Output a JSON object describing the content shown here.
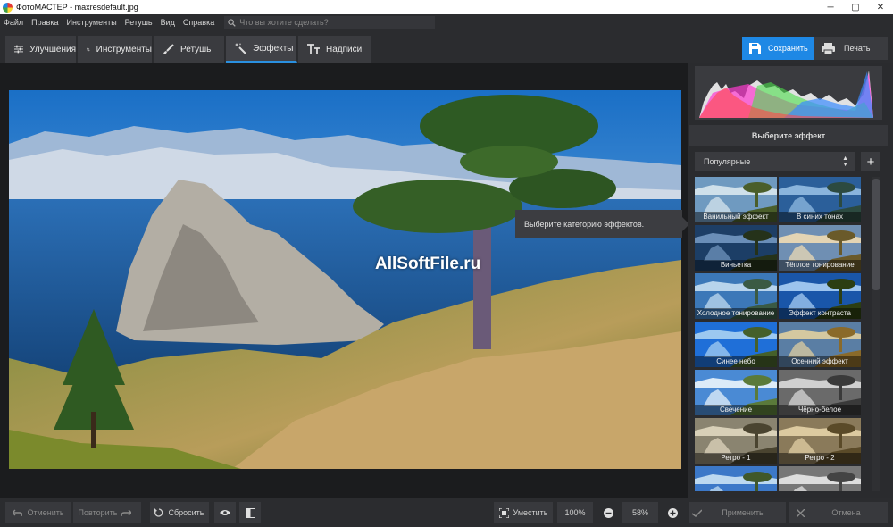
{
  "window": {
    "title": "ФотоМАСТЕР - maxresdefault.jpg",
    "controls": [
      "─",
      "▢",
      "✕"
    ]
  },
  "menu": {
    "items": [
      "Файл",
      "Правка",
      "Инструменты",
      "Ретушь",
      "Вид",
      "Справка"
    ],
    "search_placeholder": "Что вы хотите сделать?"
  },
  "tabs": [
    {
      "label": "Улучшения",
      "icon": "sliders-icon"
    },
    {
      "label": "Инструменты",
      "icon": "crop-icon"
    },
    {
      "label": "Ретушь",
      "icon": "brush-icon"
    },
    {
      "label": "Эффекты",
      "icon": "magic-wand-icon",
      "active": true
    },
    {
      "label": "Надписи",
      "icon": "text-icon"
    }
  ],
  "actions": {
    "save": "Сохранить",
    "print": "Печать"
  },
  "canvas": {
    "watermark": "AllSoftFile.ru",
    "tooltip": "Выберите категорию эффектов."
  },
  "panel": {
    "title": "Выберите эффект",
    "category": "Популярные",
    "add_label": "+",
    "effects": [
      {
        "label": "Ванильный эффект",
        "tone": "vanilla"
      },
      {
        "label": "В синих тонах",
        "tone": "blue"
      },
      {
        "label": "Виньетка",
        "tone": "vignette"
      },
      {
        "label": "Тёплое тонирование",
        "tone": "warm"
      },
      {
        "label": "Холодное тонирование",
        "tone": "cold"
      },
      {
        "label": "Эффект контраста",
        "tone": "contrast"
      },
      {
        "label": "Синее небо",
        "tone": "sky"
      },
      {
        "label": "Осенний эффект",
        "tone": "autumn"
      },
      {
        "label": "Свечение",
        "tone": "glow"
      },
      {
        "label": "Чёрно-белое",
        "tone": "bw"
      },
      {
        "label": "Ретро - 1",
        "tone": "retro1"
      },
      {
        "label": "Ретро - 2",
        "tone": "retro2"
      },
      {
        "label": "",
        "tone": "normal"
      },
      {
        "label": "",
        "tone": "gray"
      }
    ]
  },
  "bottom": {
    "undo": "Отменить",
    "redo": "Повторить",
    "reset": "Сбросить",
    "fit": "Уместить",
    "zoom_100": "100%",
    "zoom_value": "58%",
    "apply": "Применить",
    "cancel": "Отмена"
  },
  "colors": {
    "accent": "#1e88e5",
    "background": "#1f2023",
    "panel": "#2a2b2e"
  }
}
